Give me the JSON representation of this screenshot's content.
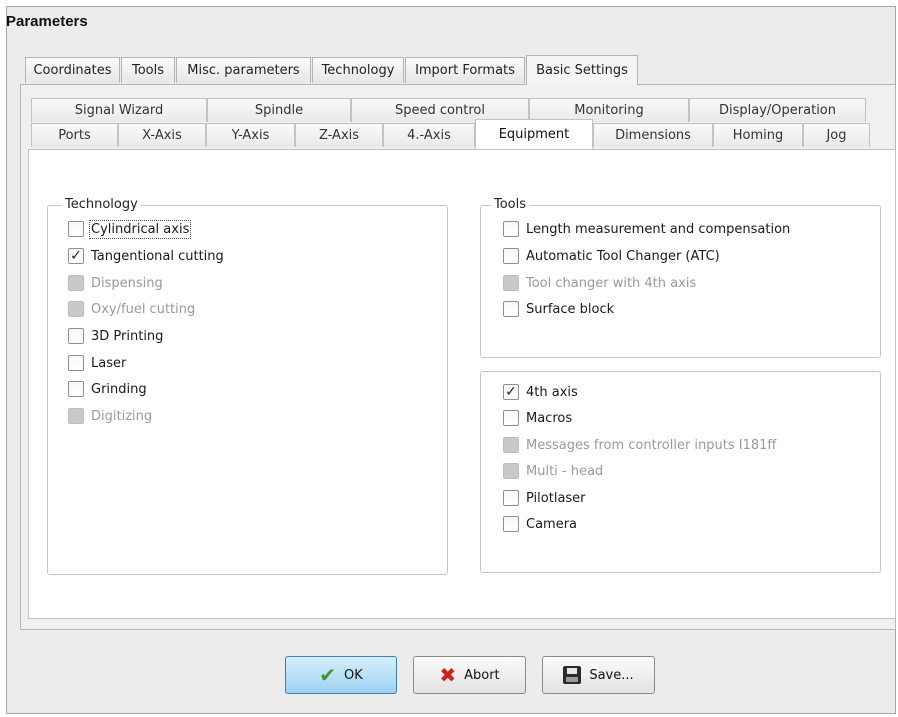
{
  "window": {
    "title": "Parameters"
  },
  "top_tabs": [
    {
      "label": "Coordinates",
      "active": false
    },
    {
      "label": "Tools",
      "active": false
    },
    {
      "label": "Misc. parameters",
      "active": false
    },
    {
      "label": "Technology",
      "active": false
    },
    {
      "label": "Import Formats",
      "active": false
    },
    {
      "label": "Basic Settings",
      "active": true
    }
  ],
  "tabs_row1": [
    "Signal Wizard",
    "Spindle",
    "Speed control",
    "Monitoring",
    "Display/Operation"
  ],
  "tabs_row2": [
    "Ports",
    "X-Axis",
    "Y-Axis",
    "Z-Axis",
    "4.-Axis",
    "Equipment",
    "Dimensions",
    "Homing",
    "Jog"
  ],
  "active_inner_tab": "Equipment",
  "technology_group": {
    "legend": "Technology",
    "items": [
      {
        "label": "Cylindrical axis",
        "checked": false,
        "enabled": true
      },
      {
        "label": "Tangentional cutting",
        "checked": true,
        "enabled": true
      },
      {
        "label": "Dispensing",
        "checked": false,
        "enabled": false
      },
      {
        "label": "Oxy/fuel cutting",
        "checked": false,
        "enabled": false
      },
      {
        "label": "3D Printing",
        "checked": false,
        "enabled": true
      },
      {
        "label": "Laser",
        "checked": false,
        "enabled": true
      },
      {
        "label": "Grinding",
        "checked": false,
        "enabled": true
      },
      {
        "label": "Digitizing",
        "checked": false,
        "enabled": false
      }
    ]
  },
  "tools_group": {
    "legend": "Tools",
    "items": [
      {
        "label": "Length measurement and compensation",
        "checked": false,
        "enabled": true
      },
      {
        "label": "Automatic Tool Changer (ATC)",
        "checked": false,
        "enabled": true
      },
      {
        "label": "Tool changer with 4th axis",
        "checked": false,
        "enabled": false
      },
      {
        "label": "Surface block",
        "checked": false,
        "enabled": true
      }
    ]
  },
  "misc_group": {
    "items": [
      {
        "label": "4th axis",
        "checked": true,
        "enabled": true
      },
      {
        "label": "Macros",
        "checked": false,
        "enabled": true
      },
      {
        "label": "Messages from controller inputs I181ff",
        "checked": false,
        "enabled": false
      },
      {
        "label": "Multi - head",
        "checked": false,
        "enabled": false
      },
      {
        "label": "Pilotlaser",
        "checked": false,
        "enabled": true
      },
      {
        "label": "Camera",
        "checked": false,
        "enabled": true
      }
    ]
  },
  "buttons": {
    "ok": "OK",
    "abort": "Abort",
    "save": "Save..."
  },
  "colors": {
    "ok_button": "#9ed2f2",
    "ok_check": "#3a9a2a",
    "abort_x": "#cc2222"
  },
  "icons": {
    "ok": "check-icon",
    "abort": "x-icon",
    "save": "floppy-disk-icon"
  }
}
